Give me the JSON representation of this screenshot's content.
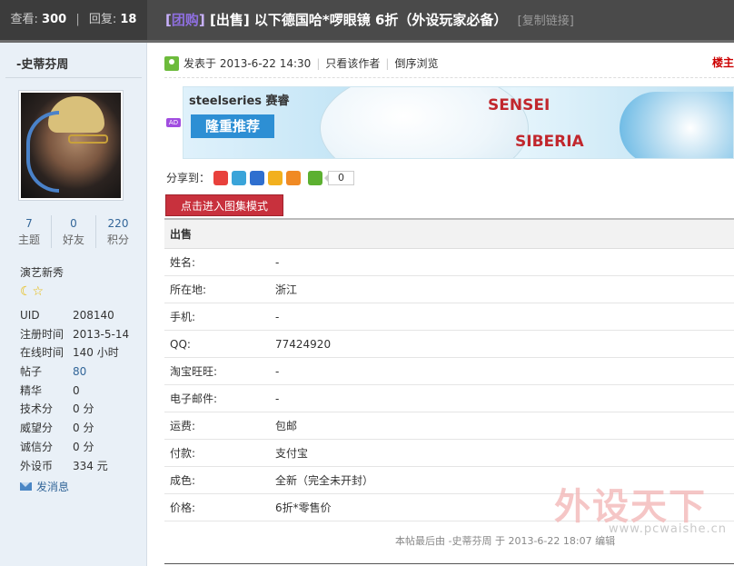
{
  "topbar": {
    "views_label": "查看:",
    "views_value": "300",
    "replies_label": "回复:",
    "replies_value": "18",
    "title_tag": "[",
    "title_tag_inner": "团购",
    "title_tag_close": "]",
    "title_type": "[出售]",
    "title_text": " 以下德国哈*啰眼镜 6折（外设玩家必备）",
    "copy_link": "[复制链接]"
  },
  "user": {
    "name": "-史蒂芬周",
    "stats": [
      {
        "num": "7",
        "label": "主题"
      },
      {
        "num": "0",
        "label": "好友"
      },
      {
        "num": "220",
        "label": "积分"
      }
    ],
    "rank": "演艺新秀",
    "rank_icons": "☾☆",
    "profile": [
      {
        "key": "UID",
        "value": "208140"
      },
      {
        "key": "注册时间",
        "value": "2013-5-14"
      },
      {
        "key": "在线时间",
        "value": "140 小时"
      },
      {
        "key": "帖子",
        "value": "80"
      },
      {
        "key": "精华",
        "value": "0"
      },
      {
        "key": "技术分",
        "value": "0 分"
      },
      {
        "key": "威望分",
        "value": "0 分"
      },
      {
        "key": "诚信分",
        "value": "0 分"
      },
      {
        "key": "外设币",
        "value": "334 元"
      }
    ],
    "pm_label": "发消息"
  },
  "post": {
    "posted_at": "发表于 2013-6-22 14:30",
    "only_author": "只看该作者",
    "reverse_order": "倒序浏览",
    "floor": "楼主",
    "ad_badge": "AD",
    "banner": {
      "brand": "steelseries 赛睿",
      "tagline": "隆重推荐",
      "product1": "SENSEI",
      "product2": "SIBERIA"
    },
    "share_label": "分享到：",
    "share_count": "0",
    "gallery_button": "点击进入图集模式",
    "table": {
      "heading": "出售",
      "rows": [
        {
          "key": "姓名:",
          "value": "-"
        },
        {
          "key": "所在地:",
          "value": "浙江"
        },
        {
          "key": "手机:",
          "value": "-"
        },
        {
          "key": "QQ:",
          "value": "77424920"
        },
        {
          "key": "淘宝旺旺:",
          "value": "-"
        },
        {
          "key": "电子邮件:",
          "value": "-"
        },
        {
          "key": "运费:",
          "value": "包邮"
        },
        {
          "key": "付款:",
          "value": "支付宝"
        },
        {
          "key": "成色:",
          "value": "全新（完全未开封）"
        },
        {
          "key": "价格:",
          "value": "6折*零售价"
        }
      ]
    },
    "last_edit": "本帖最后由 -史蒂芬周 于 2013-6-22 18:07 编辑"
  },
  "watermark": {
    "text": "外设天下",
    "url": "www.pcwaishe.cn"
  },
  "colors": {
    "topbar_bg": "#4a4a4a",
    "sidebar_bg": "#e9f0f7",
    "link": "#336699",
    "gallery_btn": "#c8313d",
    "floor": "#cc0000"
  },
  "share_icons": [
    "weibo-icon",
    "tencent-weibo-icon",
    "renren-icon",
    "qzone-icon",
    "kaixin-icon",
    "more-share-icon"
  ]
}
